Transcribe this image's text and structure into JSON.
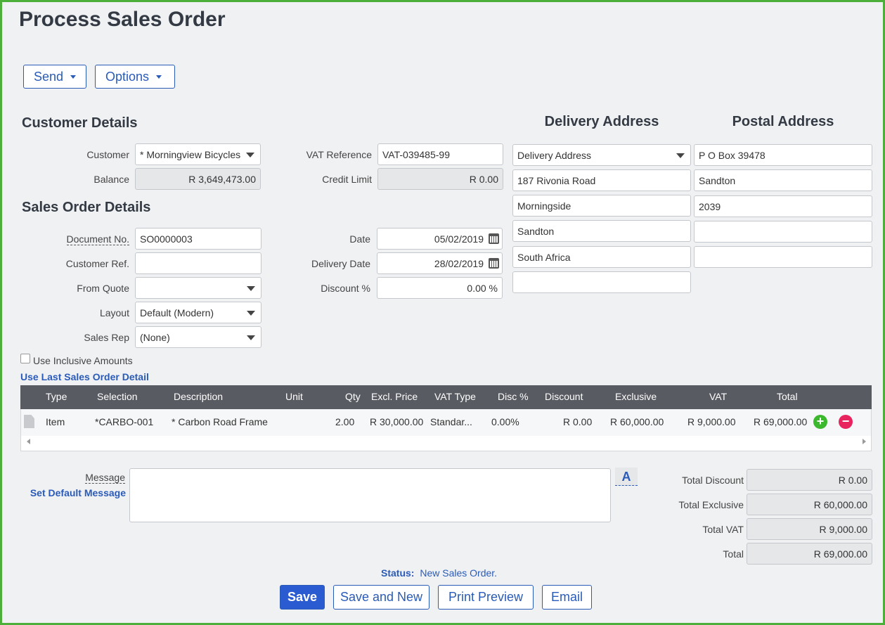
{
  "page_title": "Process Sales Order",
  "toolbar": {
    "send_label": "Send",
    "options_label": "Options"
  },
  "customer_details": {
    "title": "Customer Details",
    "customer_label": "Customer",
    "customer_value": "* Morningview Bicycles",
    "balance_label": "Balance",
    "balance_value": "R 3,649,473.00",
    "vat_ref_label": "VAT Reference",
    "vat_ref_value": "VAT-039485-99",
    "credit_limit_label": "Credit Limit",
    "credit_limit_value": "R 0.00"
  },
  "sales_order_details": {
    "title": "Sales Order Details",
    "document_no_label": "Document No.",
    "document_no_value": "SO0000003",
    "customer_ref_label": "Customer Ref.",
    "customer_ref_value": "",
    "from_quote_label": "From Quote",
    "from_quote_value": "",
    "layout_label": "Layout",
    "layout_value": "Default (Modern)",
    "sales_rep_label": "Sales Rep",
    "sales_rep_value": "(None)",
    "date_label": "Date",
    "date_value": "05/02/2019",
    "delivery_date_label": "Delivery Date",
    "delivery_date_value": "28/02/2019",
    "discount_label": "Discount %",
    "discount_value": "0.00 %"
  },
  "delivery_address": {
    "title": "Delivery Address",
    "selector_value": "Delivery Address",
    "lines": [
      "187 Rivonia Road",
      "Morningside",
      "Sandton",
      "South Africa",
      ""
    ]
  },
  "postal_address": {
    "title": "Postal Address",
    "lines": [
      "P O Box 39478",
      "Sandton",
      "2039",
      "",
      ""
    ]
  },
  "use_inclusive_label": "Use Inclusive Amounts",
  "use_last_detail_link": "Use Last Sales Order Detail",
  "grid": {
    "headers": [
      "Type",
      "Selection",
      "Description",
      "Unit",
      "Qty",
      "Excl. Price",
      "VAT Type",
      "Disc %",
      "Discount",
      "Exclusive",
      "VAT",
      "Total"
    ],
    "rows": [
      {
        "type": "Item",
        "selection": "*CARBO-001",
        "description": "* Carbon Road Frame",
        "unit": "",
        "qty": "2.00",
        "excl_price": "R 30,000.00",
        "vat_type": "Standar...",
        "disc_pct": "0.00%",
        "discount": "R 0.00",
        "exclusive": "R 60,000.00",
        "vat": "R 9,000.00",
        "total": "R 69,000.00"
      }
    ]
  },
  "message": {
    "label": "Message",
    "set_default_link": "Set Default Message",
    "value": "",
    "format_button": "A"
  },
  "totals": {
    "total_discount_label": "Total Discount",
    "total_discount_value": "R 0.00",
    "total_exclusive_label": "Total Exclusive",
    "total_exclusive_value": "R 60,000.00",
    "total_vat_label": "Total VAT",
    "total_vat_value": "R 9,000.00",
    "total_label": "Total",
    "total_value": "R 69,000.00"
  },
  "status": {
    "label": "Status:",
    "value": "New Sales Order."
  },
  "actions": {
    "save": "Save",
    "save_and_new": "Save and New",
    "print_preview": "Print Preview",
    "email": "Email"
  },
  "colors": {
    "accent": "#2a5bb8",
    "frame_border": "#4caf3a",
    "grid_header": "#585b61",
    "add_button": "#3cb82e",
    "remove_button": "#e8245e"
  },
  "icons": [
    "caret-down-icon",
    "calendar-icon",
    "document-icon",
    "add-icon",
    "remove-icon"
  ]
}
